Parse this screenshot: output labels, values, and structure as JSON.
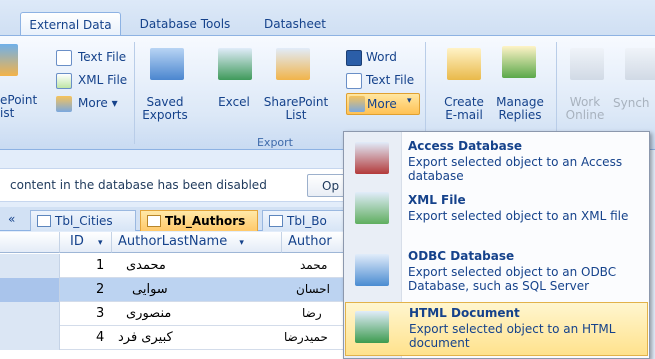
{
  "ribbon": {
    "tabs": [
      "External Data",
      "Database Tools",
      "Datasheet"
    ],
    "import_group": {
      "text_file": "Text File",
      "xml_file": "XML File",
      "more": "More",
      "sharepoint_list_line1": "ePoint",
      "sharepoint_list_line2": "ist"
    },
    "export_group": {
      "saved_exports_line1": "Saved",
      "saved_exports_line2": "Exports",
      "excel": "Excel",
      "sharepoint_list_line1": "SharePoint",
      "sharepoint_list_line2": "List",
      "word": "Word",
      "text_file": "Text File",
      "more": "More",
      "label": "Export"
    },
    "collect_group": {
      "create_email_line1": "Create",
      "create_email_line2": "E-mail",
      "manage_replies_line1": "Manage",
      "manage_replies_line2": "Replies"
    },
    "sharepoint_group": {
      "work_online_line1": "Work",
      "work_online_line2": "Online",
      "synchronize": "Synch"
    }
  },
  "message_bar": {
    "text": "content in the database has been disabled",
    "options_button": "Op"
  },
  "doc_tabs": {
    "scroll": "«",
    "items": [
      "Tbl_Cities",
      "Tbl_Authors",
      "Tbl_Bo"
    ]
  },
  "table": {
    "columns": [
      "ID",
      "AuthorLastName",
      "Author"
    ],
    "rows": [
      {
        "id": "1",
        "last": "محمدی",
        "first": "محمد"
      },
      {
        "id": "2",
        "last": "سوایی",
        "first": "احسان"
      },
      {
        "id": "3",
        "last": "منصوری",
        "first": "رضا"
      },
      {
        "id": "4",
        "last": "کبیری فرد",
        "first": "حمیدرضا"
      }
    ]
  },
  "export_menu": {
    "items": [
      {
        "title": "Access Database",
        "desc": "Export selected object to an Access database"
      },
      {
        "title": "XML File",
        "desc": "Export selected object to an XML file"
      },
      {
        "title": "ODBC Database",
        "desc": "Export selected object to an ODBC Database, such as SQL Server"
      },
      {
        "title": "HTML Document",
        "desc": "Export selected object to an HTML document"
      }
    ]
  },
  "colors": {
    "ribbon_text": "#15428b",
    "highlight": "#ffe28d",
    "active_tab": "#ffc96a"
  }
}
